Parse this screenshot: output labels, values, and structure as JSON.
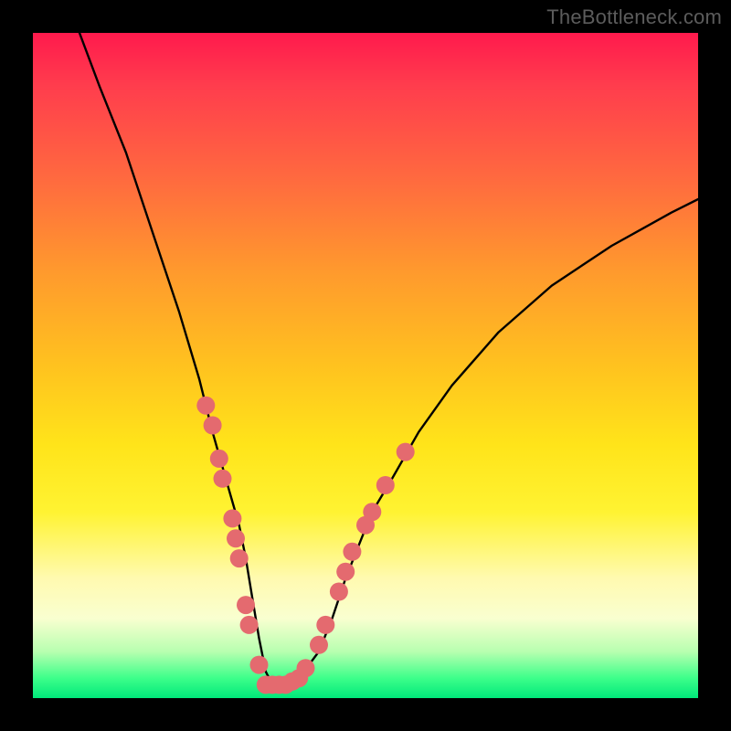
{
  "watermark": "TheBottleneck.com",
  "chart_data": {
    "type": "line",
    "title": "",
    "xlabel": "",
    "ylabel": "",
    "xlim": [
      0,
      100
    ],
    "ylim": [
      0,
      100
    ],
    "grid": false,
    "legend": false,
    "series": [
      {
        "name": "bottleneck-curve",
        "x": [
          7,
          10,
          14,
          18,
          22,
          25,
          27,
          29,
          31,
          32,
          33,
          34,
          35,
          36,
          38,
          40,
          43,
          45,
          47,
          49,
          51,
          54,
          58,
          63,
          70,
          78,
          87,
          96,
          100
        ],
        "y": [
          100,
          92,
          82,
          70,
          58,
          48,
          40,
          33,
          26,
          21,
          15,
          9,
          4,
          2,
          2,
          3,
          7,
          12,
          18,
          23,
          28,
          33,
          40,
          47,
          55,
          62,
          68,
          73,
          75
        ]
      }
    ],
    "markers": {
      "name": "highlight-dots",
      "color": "#e46a6f",
      "radius_px": 10,
      "points": [
        {
          "x": 26,
          "y": 44
        },
        {
          "x": 27,
          "y": 41
        },
        {
          "x": 28,
          "y": 36
        },
        {
          "x": 28.5,
          "y": 33
        },
        {
          "x": 30,
          "y": 27
        },
        {
          "x": 30.5,
          "y": 24
        },
        {
          "x": 31,
          "y": 21
        },
        {
          "x": 32,
          "y": 14
        },
        {
          "x": 32.5,
          "y": 11
        },
        {
          "x": 34,
          "y": 5
        },
        {
          "x": 35,
          "y": 2
        },
        {
          "x": 36,
          "y": 2
        },
        {
          "x": 37,
          "y": 2
        },
        {
          "x": 38,
          "y": 2
        },
        {
          "x": 39,
          "y": 2.5
        },
        {
          "x": 40,
          "y": 3
        },
        {
          "x": 41,
          "y": 4.5
        },
        {
          "x": 43,
          "y": 8
        },
        {
          "x": 44,
          "y": 11
        },
        {
          "x": 46,
          "y": 16
        },
        {
          "x": 47,
          "y": 19
        },
        {
          "x": 48,
          "y": 22
        },
        {
          "x": 50,
          "y": 26
        },
        {
          "x": 51,
          "y": 28
        },
        {
          "x": 53,
          "y": 32
        },
        {
          "x": 56,
          "y": 37
        }
      ]
    }
  }
}
